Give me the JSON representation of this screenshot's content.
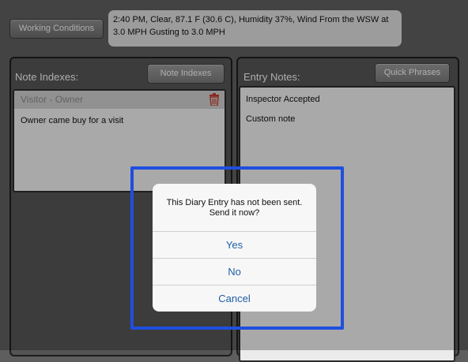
{
  "toolbar": {
    "working_conditions_label": "Working Conditions"
  },
  "weather": {
    "line1": "2:40 PM, Clear, 87.1 F (30.6 C), Humidity 37%, Wind From the WSW at",
    "line2": "3.0 MPH Gusting to 3.0 MPH"
  },
  "left_panel": {
    "title": "Note Indexes:",
    "button_label": "Note Indexes",
    "selected_index": "Visitor - Owner",
    "note_text": "Owner came buy for a visit"
  },
  "right_panel": {
    "title": "Entry Notes:",
    "button_label": "Quick Phrases",
    "notes": [
      "Inspector Accepted",
      "Custom note"
    ]
  },
  "dialog": {
    "message_line1": "This Diary Entry has not been sent.",
    "message_line2": "Send it now?",
    "yes_label": "Yes",
    "no_label": "No",
    "cancel_label": "Cancel"
  },
  "colors": {
    "dialog_action": "#1e5ea8",
    "highlight_frame": "#1f4fe0",
    "delete_icon": "#c0392b"
  },
  "icons": {
    "delete": "trash-icon"
  }
}
